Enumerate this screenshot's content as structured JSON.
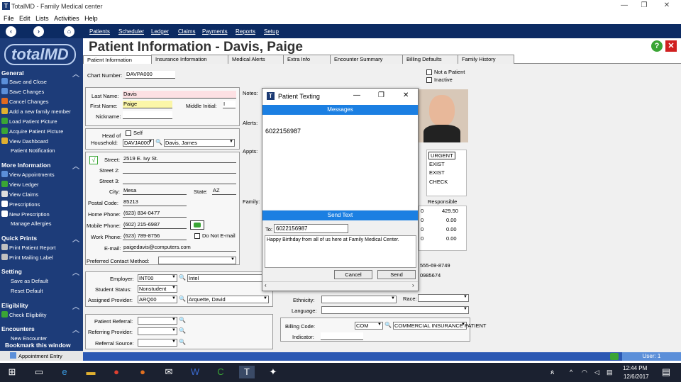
{
  "window": {
    "title": "TotalMD - Family Medical center",
    "minimize": "—",
    "restore": "❐",
    "close": "✕"
  },
  "menu": [
    "File",
    "Edit",
    "Lists",
    "Activities",
    "Help"
  ],
  "nav": [
    "Patients",
    "Scheduler",
    "Ledger",
    "Claims",
    "Payments",
    "Reports",
    "Setup"
  ],
  "logo": "totalMD",
  "sidebar": {
    "general": "General",
    "save_close": "Save and Close",
    "save_changes": "Save Changes",
    "cancel_changes": "Cancel Changes",
    "add_family": "Add a new family member",
    "load_pic": "Load Patient Picture",
    "acquire_pic": "Acquire Patient Picture",
    "view_dash": "View Dashboard",
    "patient_notif": "Patient Notification",
    "more": "More Information",
    "view_appts": "View Appointments",
    "view_ledger": "View Ledger",
    "view_claims": "View Claims",
    "prescriptions": "Prescriptions",
    "new_rx": "New Prescription",
    "manage_allergies": "Manage Allergies",
    "quick": "Quick Prints",
    "print_report": "Print Patient Report",
    "print_label": "Print Mailing Label",
    "setting": "Setting",
    "save_default": "Save as Default",
    "reset_default": "Reset Default",
    "eligibility": "Eligibility",
    "check_elig": "Check Eligibility",
    "encounters": "Encounters",
    "new_enc": "New Encounter",
    "bookmark": "Bookmark this window",
    "appt_entry": "Appointment Entry"
  },
  "header": {
    "title": "Patient Information - Davis, Paige",
    "help": "?",
    "close": "✕"
  },
  "tabs": [
    "Patient Information",
    "Insurance Information",
    "Medical Alerts",
    "Extra Info",
    "Encounter Summary",
    "Billing Defaults",
    "Family History"
  ],
  "form": {
    "chart_lbl": "Chart Number:",
    "chart": "DAVPA000",
    "not_patient": "Not a Patient",
    "inactive": "Inactive",
    "last_lbl": "Last Name:",
    "last": "Davis",
    "first_lbl": "First Name:",
    "first": "Paige",
    "mi_lbl": "Middle Initial:",
    "mi": "I",
    "nick_lbl": "Nickname:",
    "head_lbl": "Head of",
    "self": "Self",
    "household_lbl": "Household:",
    "household": "DAVJA000",
    "household_name": "Davis, James",
    "street_lbl": "Street:",
    "street": "2519 E. Ivy St.",
    "street2_lbl": "Street 2:",
    "street3_lbl": "Street 3:",
    "city_lbl": "City:",
    "city": "Mesa",
    "state_lbl": "State:",
    "state": "AZ",
    "zip_lbl": "Postal Code:",
    "zip": "85213",
    "home_lbl": "Home Phone:",
    "home": "(623) 834-0477",
    "mobile_lbl": "Mobile Phone:",
    "mobile": "(602) 215-6987",
    "work_lbl": "Work Phone:",
    "work": "(623) 789-8756",
    "no_email": "Do Not E-mail",
    "email_lbl": "E-mail:",
    "email": "paigedavis@computers.com",
    "pcm_lbl": "Preferred Contact Method:",
    "employer_lbl": "Employer:",
    "employer": "INT00",
    "employer_name": "Intel",
    "student_lbl": "Student Status:",
    "student": "Nonstudent",
    "provider_lbl": "Assigned Provider:",
    "provider": "ARQ00",
    "provider_name": "Arquette, David",
    "referral_lbl": "Patient Referral:",
    "ref_prov_lbl": "Referring Provider:",
    "ref_src_lbl": "Referral Source:",
    "notes_lbl": "Notes:",
    "alerts_lbl": "Alerts:",
    "appts_lbl": "Appts:",
    "family_lbl": "Family:",
    "ethnicity_lbl": "Ethnicity:",
    "race_lbl": "Race:",
    "language_lbl": "Language:",
    "billing_lbl": "Billing Code:",
    "billing": "COM",
    "billing_name": "COMMERCIAL INSURANCE PATIENT",
    "indicator_lbl": "Indicator:",
    "ssn": "555-69-8749",
    "idnum": "0985674",
    "status_list": [
      "URGENT",
      "EXIST",
      "EXIST",
      "CHECK"
    ],
    "responsible_lbl": "Responsible",
    "bal_rows": [
      {
        "a": "0",
        "b": "429.50"
      },
      {
        "a": "0",
        "b": "0.00"
      },
      {
        "a": "0",
        "b": "0.00"
      },
      {
        "a": "0",
        "b": "0.00"
      }
    ]
  },
  "dialog": {
    "title": "Patient Texting",
    "messages": "Messages",
    "phone": "6022156987",
    "send_text": "Send Text",
    "to_lbl": "To:",
    "to": "6022156987",
    "body": "Happy Birthday from all of us here at Family Medical Center.",
    "cancel": "Cancel",
    "send": "Send"
  },
  "status": {
    "user": "User: 1"
  },
  "clock": {
    "time": "12:44 PM",
    "date": "12/6/2017"
  }
}
